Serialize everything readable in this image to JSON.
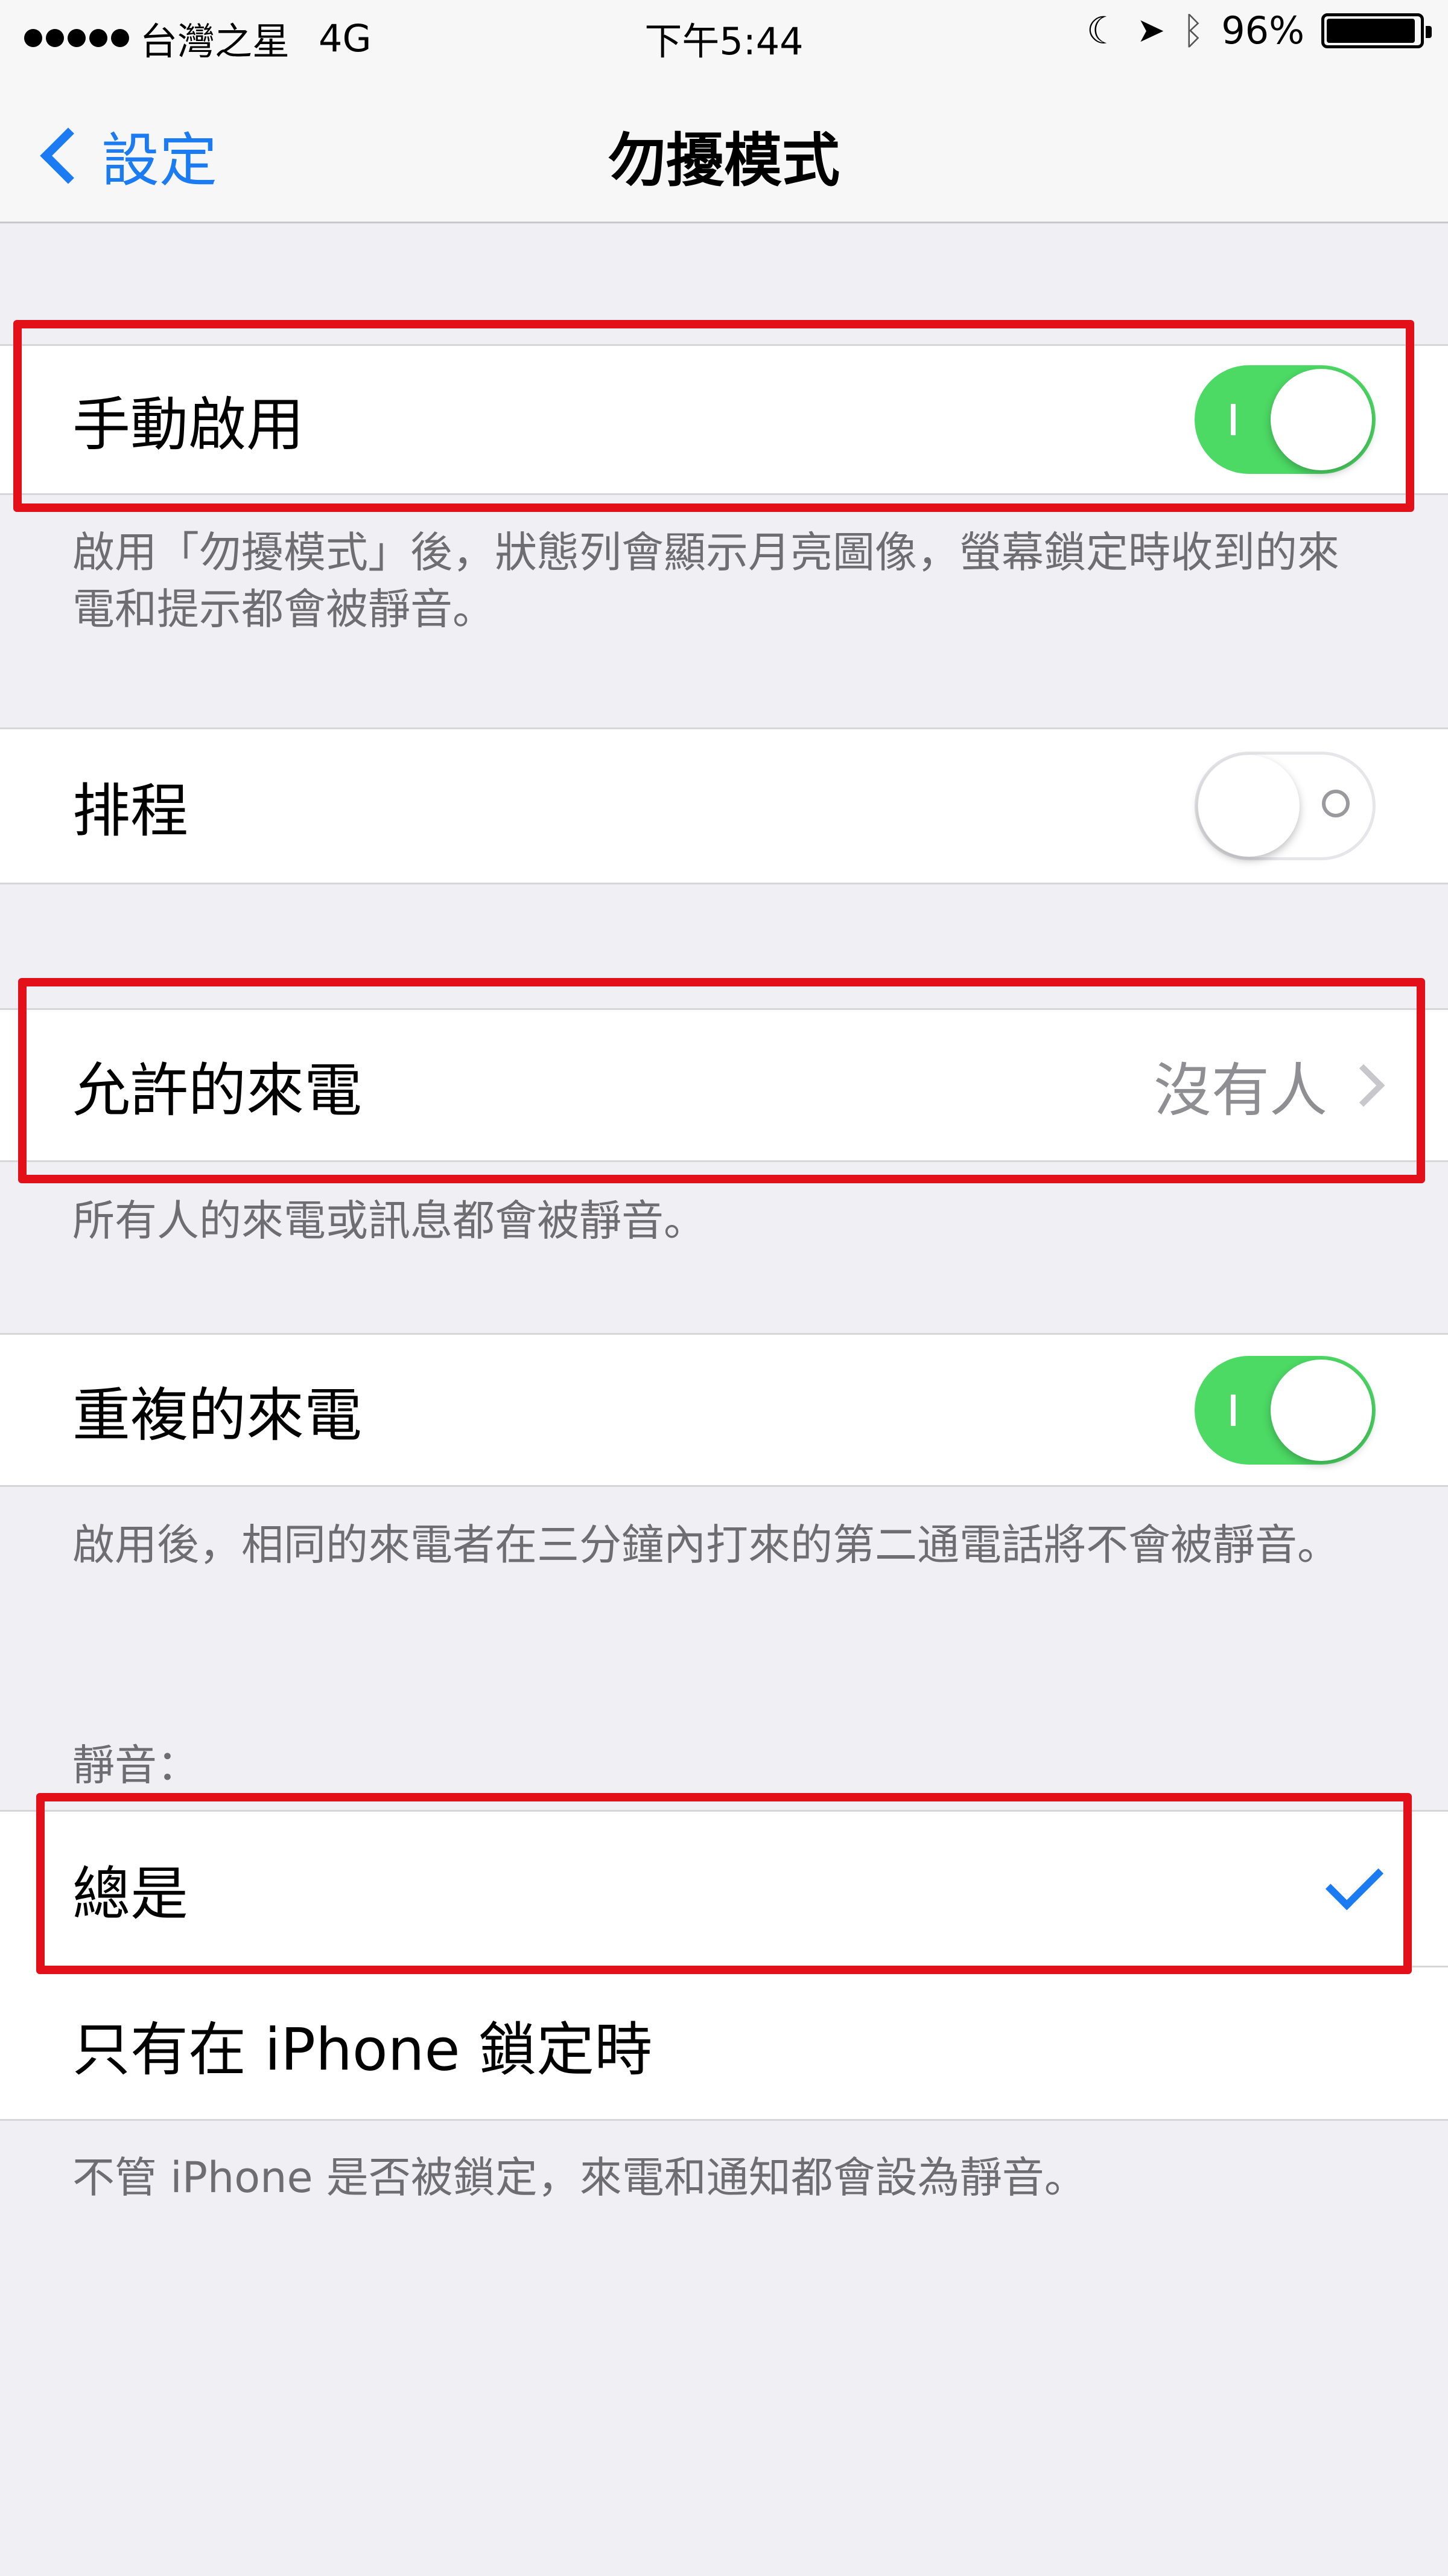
{
  "status_bar": {
    "carrier": "台灣之星",
    "network": "4G",
    "time": "下午5:44",
    "battery": "96%",
    "battery_level": 0.96
  },
  "nav": {
    "back_label": "設定",
    "title": "勿擾模式"
  },
  "manual": {
    "label": "手動啟用",
    "enabled": true,
    "description": "啟用「勿擾模式」後，狀態列會顯示月亮圖像，螢幕鎖定時收到的來電和提示都會被靜音。"
  },
  "schedule": {
    "label": "排程",
    "enabled": false
  },
  "allow_calls": {
    "label": "允許的來電",
    "value": "沒有人",
    "description": "所有人的來電或訊息都會被靜音。"
  },
  "repeated_calls": {
    "label": "重複的來電",
    "enabled": true,
    "description": "啟用後，相同的來電者在三分鐘內打來的第二通電話將不會被靜音。"
  },
  "silence": {
    "header": "靜音：",
    "options": [
      "總是",
      "只有在 iPhone 鎖定時"
    ],
    "selected": "總是",
    "description": "不管 iPhone 是否被鎖定，來電和通知都會設為靜音。"
  },
  "colors": {
    "accent": "#1b7bf2",
    "switch_on": "#4cd964",
    "highlight": "#e3101a"
  }
}
